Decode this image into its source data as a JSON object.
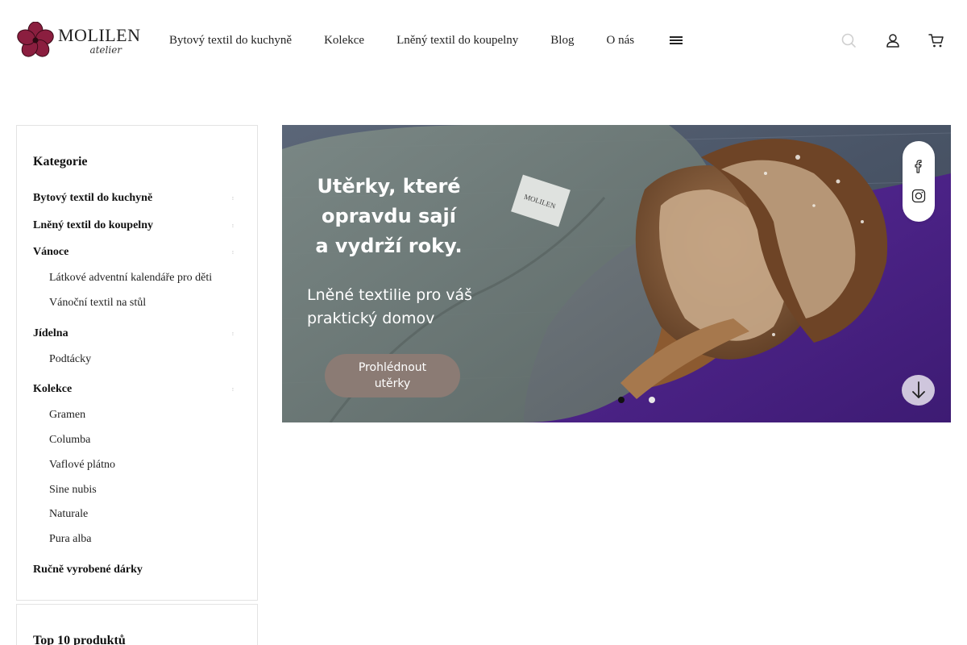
{
  "brand": {
    "name": "MOLILEN",
    "subtitle": "atelier"
  },
  "nav": {
    "items": [
      {
        "label": "Bytový textil do kuchyně"
      },
      {
        "label": "Kolekce"
      },
      {
        "label": "Lněný textil do koupelny"
      },
      {
        "label": "Blog"
      },
      {
        "label": "O nás"
      }
    ]
  },
  "sidebar": {
    "title": "Kategorie",
    "categories": [
      {
        "label": "Bytový textil do kuchyně"
      },
      {
        "label": "Lněný textil do koupelny"
      },
      {
        "label": "Vánoce",
        "children": [
          "Látkové adventní kalendáře pro děti",
          "Vánoční textil na stůl"
        ]
      },
      {
        "label": "Jídelna",
        "children": [
          "Podtácky"
        ]
      },
      {
        "label": "Kolekce",
        "children": [
          "Gramen",
          "Columba",
          "Vaflové plátno",
          "Sine nubis",
          "Naturale",
          "Pura alba"
        ]
      },
      {
        "label": "Ručně vyrobené dárky"
      }
    ],
    "top10_title": "Top 10 produktů"
  },
  "hero": {
    "headline": [
      "Utěrky, které",
      "opravdu sají",
      "a vydrží roky."
    ],
    "subheadline": [
      "Lněné textilie pro váš",
      "praktický domov"
    ],
    "button_label": "Prohlédnout utěrky",
    "slides": {
      "count": 2,
      "active": 1
    },
    "towel_label": "MOLILEN"
  },
  "icons": {
    "header": [
      "search-icon",
      "user-icon",
      "cart-icon",
      "menu-icon"
    ],
    "social": [
      "facebook-icon",
      "instagram-icon"
    ]
  },
  "colors": {
    "accent": "#8b1e3f",
    "button": "#8b7b74",
    "text": "#111111",
    "border": "#e3e3e3"
  }
}
